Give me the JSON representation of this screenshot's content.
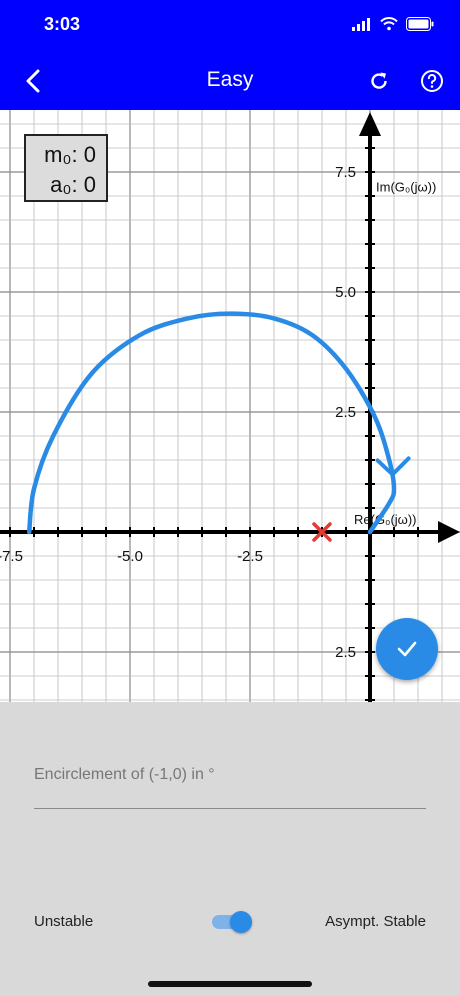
{
  "status_bar": {
    "time": "3:03"
  },
  "app_bar": {
    "title": "Easy"
  },
  "plot": {
    "x_tick_labels": [
      "-7.5",
      "-5.0",
      "-2.5"
    ],
    "y_tick_labels": [
      "7.5",
      "5.0",
      "2.5",
      "2.5"
    ],
    "y_axis_label": "Im(G₀(jω))",
    "x_axis_label": "Re(G₀(jω))",
    "legend": {
      "m0": "m₀: 0",
      "a0": "a₀: 0"
    },
    "colors": {
      "curve": "#2a8be6",
      "critical_point": "#e53935",
      "axes": "#000000"
    }
  },
  "chart_data": {
    "type": "line",
    "xlim": [
      -7.7,
      1.9
    ],
    "ylim": [
      -3.5,
      8.6
    ],
    "grid": true,
    "series": [
      {
        "x": [
          -7.1,
          -7.0,
          -6.6,
          -5.8,
          -4.8,
          -3.8,
          -2.9,
          -2.0,
          -1.2,
          -0.5,
          0.1,
          0.4,
          0.5,
          0.4,
          0.0
        ],
        "y": [
          0.0,
          0.9,
          2.0,
          3.3,
          4.1,
          4.45,
          4.55,
          4.45,
          4.1,
          3.4,
          2.4,
          1.5,
          0.9,
          0.6,
          0.0
        ]
      }
    ],
    "critical_point": [
      -1,
      0
    ]
  },
  "bottom_panel": {
    "encirclement_placeholder": "Encirclement of (-1,0) in °",
    "encirclement_value": "",
    "toggle_left_label": "Unstable",
    "toggle_right_label": "Asympt. Stable",
    "toggle_on": true
  }
}
